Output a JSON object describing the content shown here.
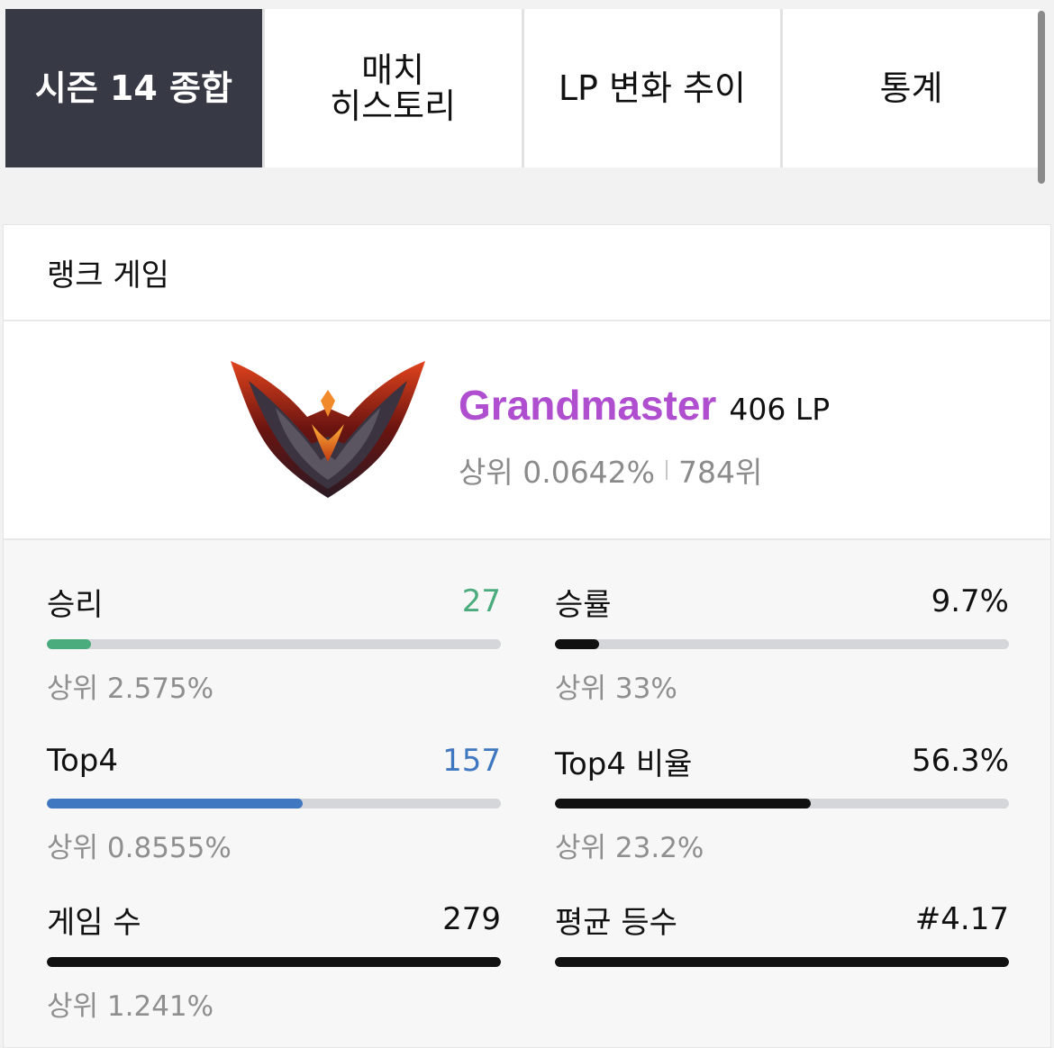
{
  "tabs": [
    {
      "label": "시즌 14 종합",
      "active": true
    },
    {
      "label": "매치\n히스토리",
      "active": false
    },
    {
      "label": "LP 변화 추이",
      "active": false
    },
    {
      "label": "통계",
      "active": false
    }
  ],
  "card": {
    "title": "랭크 게임",
    "rank": {
      "tier": "Grandmaster",
      "lp": "406 LP",
      "top_percent": "상위 0.0642%",
      "position": "784위",
      "tier_color": "#b04ed0"
    }
  },
  "stats": [
    {
      "label": "승리",
      "value": "27",
      "value_color": "#4aab7d",
      "bar_color": "#4aab7d",
      "fill_fraction": 0.097,
      "sub": "상위 2.575%"
    },
    {
      "label": "승률",
      "value": "9.7%",
      "value_color": "#111111",
      "bar_color": "#111111",
      "fill_fraction": 0.097,
      "sub": "상위 33%"
    },
    {
      "label": "Top4",
      "value": "157",
      "value_color": "#3f78c0",
      "bar_color": "#3f78c0",
      "fill_fraction": 0.563,
      "sub": "상위 0.8555%"
    },
    {
      "label": "Top4 비율",
      "value": "56.3%",
      "value_color": "#111111",
      "bar_color": "#111111",
      "fill_fraction": 0.563,
      "sub": "상위 23.2%"
    },
    {
      "label": "게임 수",
      "value": "279",
      "value_color": "#111111",
      "bar_color": "#111111",
      "fill_fraction": 1.0,
      "sub": "상위 1.241%"
    },
    {
      "label": "평균 등수",
      "value": "#4.17",
      "value_color": "#111111",
      "bar_color": "#111111",
      "fill_fraction": 1.0,
      "sub": ""
    }
  ]
}
